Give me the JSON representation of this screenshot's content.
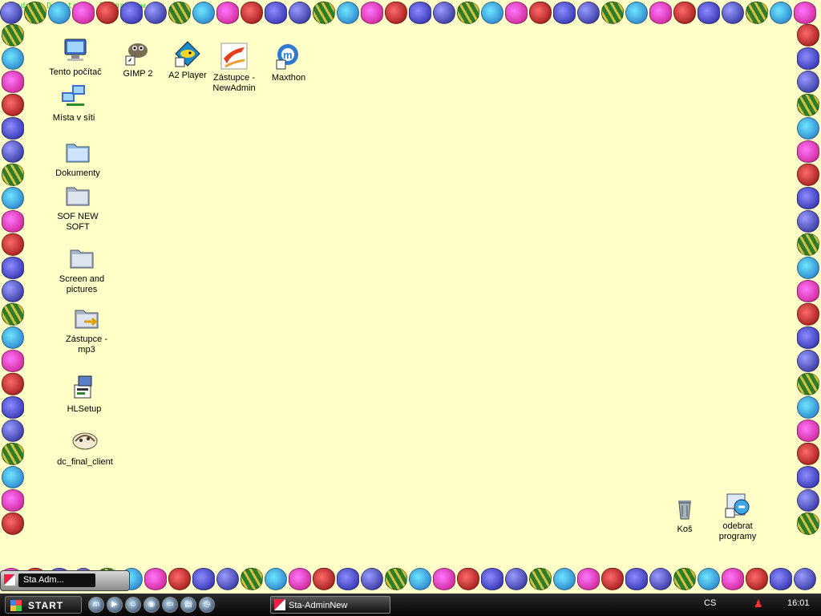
{
  "window": {
    "overlay_text": "Windows Desktop - IrfanView",
    "accent_color": "#2bd42b"
  },
  "desktop": {
    "background_color": "#ffffc8",
    "icons": [
      {
        "id": "my-computer",
        "label": "Tento počítač",
        "icon": "computer-icon"
      },
      {
        "id": "network-places",
        "label": "Místa v síti",
        "icon": "network-icon"
      },
      {
        "id": "documents",
        "label": "Dokumenty",
        "icon": "folder-icon"
      },
      {
        "id": "sof-new-soft",
        "label": "SOF NEW SOFT",
        "icon": "folder-icon"
      },
      {
        "id": "screen-pictures",
        "label": "Screen and pictures",
        "icon": "folder-icon"
      },
      {
        "id": "shortcut-mp3",
        "label": "Zástupce - mp3",
        "icon": "folder-shortcut-icon"
      },
      {
        "id": "hlsetup",
        "label": "HLSetup",
        "icon": "installer-icon"
      },
      {
        "id": "dc-final-client",
        "label": "dc_final_client",
        "icon": "shell-icon"
      },
      {
        "id": "gimp2",
        "label": "GIMP 2",
        "icon": "gimp-icon"
      },
      {
        "id": "a2player",
        "label": "A2 Player",
        "icon": "player-icon"
      },
      {
        "id": "shortcut-newadmin",
        "label": "Zástupce - NewAdmin",
        "icon": "newadmin-icon"
      },
      {
        "id": "maxthon",
        "label": "Maxthon",
        "icon": "maxthon-icon"
      },
      {
        "id": "recycle-bin",
        "label": "Koš",
        "icon": "trash-icon"
      },
      {
        "id": "remove-programs",
        "label": "odebrat programy",
        "icon": "remove-programs-icon"
      }
    ]
  },
  "mini_task": {
    "label": "Sta Adm..."
  },
  "taskbar": {
    "start_label": "START",
    "quick_launch": [
      "maxthon-icon",
      "media-icon",
      "people-icon",
      "browser-icon",
      "desktop-icon",
      "window-icon",
      "clock-icon"
    ],
    "task_button_label": "Sta-AdminNew",
    "language": "CS",
    "clock": "16:01"
  }
}
